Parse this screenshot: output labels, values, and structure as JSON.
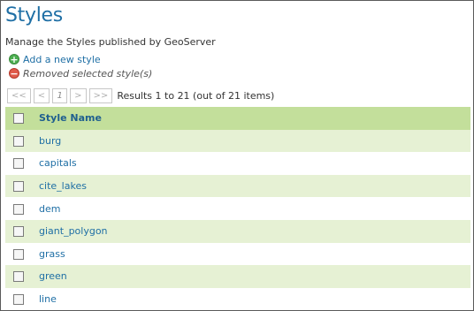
{
  "page": {
    "title": "Styles",
    "description": "Manage the Styles published by GeoServer"
  },
  "actions": {
    "add_label": "Add a new style",
    "remove_label": "Removed selected style(s)"
  },
  "pager": {
    "first": "<<",
    "prev": "<",
    "current": "1",
    "next": ">",
    "last": ">>",
    "results": "Results 1 to 21 (out of 21 items)"
  },
  "table": {
    "header": "Style Name",
    "rows": [
      "burg",
      "capitals",
      "cite_lakes",
      "dem",
      "giant_polygon",
      "grass",
      "green",
      "line"
    ]
  },
  "colors": {
    "header_bg": "#c3df9b",
    "row_alt_bg": "#e6f1d4",
    "link": "#1f6fa5"
  }
}
